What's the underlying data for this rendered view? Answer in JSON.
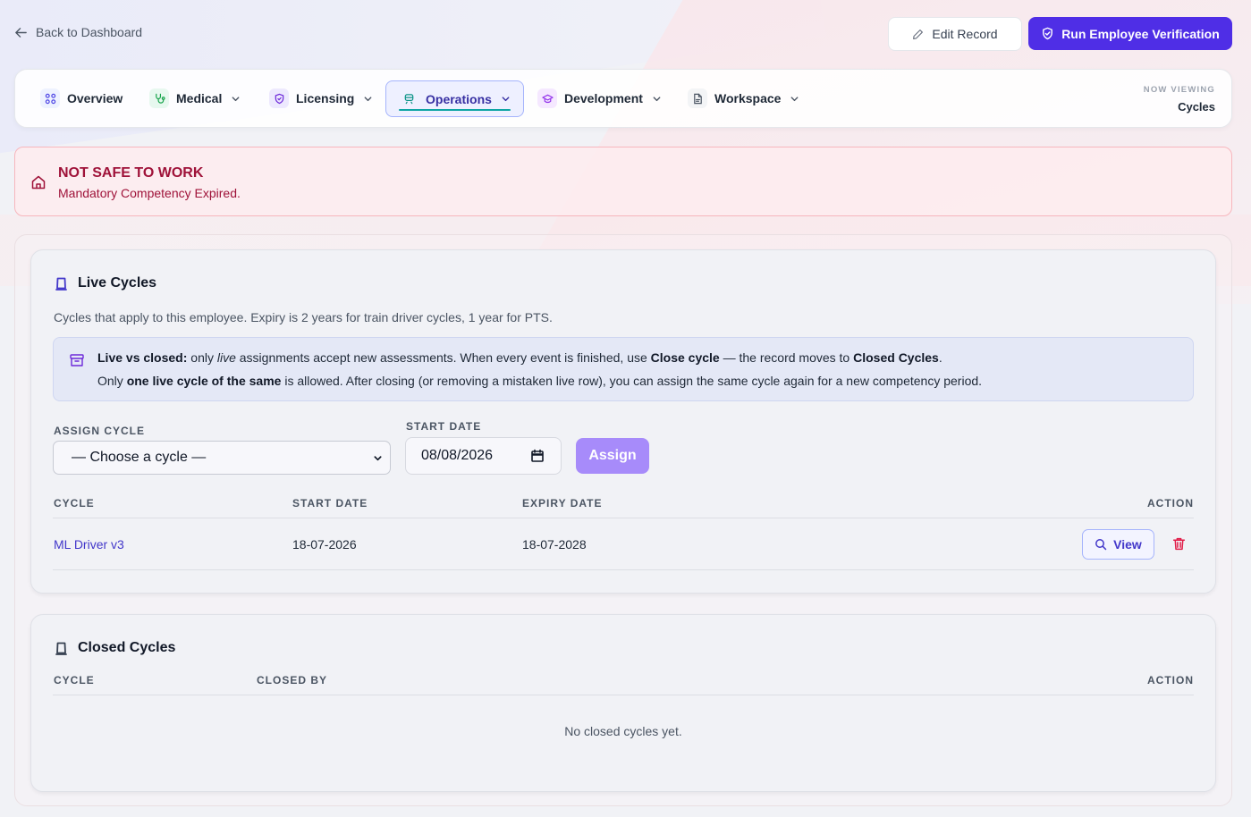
{
  "topbar": {
    "back_label": "Back to Dashboard",
    "edit_label": "Edit Record",
    "verify_label": "Run Employee Verification"
  },
  "nav": {
    "items": [
      {
        "label": "Overview",
        "icon": "grid-icon"
      },
      {
        "label": "Medical",
        "icon": "stethoscope-icon"
      },
      {
        "label": "Licensing",
        "icon": "shield-icon"
      },
      {
        "label": "Operations",
        "icon": "train-icon"
      },
      {
        "label": "Development",
        "icon": "graduation-cap-icon"
      },
      {
        "label": "Workspace",
        "icon": "document-icon"
      }
    ],
    "now_viewing_label": "NOW VIEWING",
    "now_viewing_value": "Cycles"
  },
  "alert": {
    "title": "NOT SAFE TO WORK",
    "message": "Mandatory Competency Expired."
  },
  "live": {
    "title": "Live Cycles",
    "description": "Cycles that apply to this employee. Expiry is 2 years for train driver cycles, 1 year for PTS.",
    "info": {
      "l1_b1": "Live vs closed:",
      "l1_t1": " only ",
      "l1_i1": "live",
      "l1_t2": " assignments accept new assessments. When every event is finished, use ",
      "l1_b2": "Close cycle",
      "l1_t3": " — the record moves to ",
      "l1_b3": "Closed Cycles",
      "l1_t4": ".",
      "l2_t1": "Only ",
      "l2_b1": "one live cycle of the same",
      "l2_t2": " is allowed. After closing (or removing a mistaken live row), you can assign the same cycle again for a new competency period."
    },
    "assign_cycle_label": "ASSIGN CYCLE",
    "select_value": "— Choose a cycle —",
    "start_date_label": "START DATE",
    "start_date_value": "08/08/2026",
    "assign_label": "Assign",
    "columns": [
      "CYCLE",
      "START DATE",
      "EXPIRY DATE",
      "ACTION"
    ],
    "rows": [
      {
        "cycle": "ML Driver v3",
        "start": "18-07-2026",
        "expiry": "18-07-2028",
        "view_label": "View"
      }
    ]
  },
  "closed": {
    "title": "Closed Cycles",
    "columns": [
      "CYCLE",
      "CLOSED BY",
      "ACTION"
    ],
    "empty_text": "No closed cycles yet."
  },
  "colors": {
    "accent": "#4f2ee6",
    "danger": "#9f1239",
    "link": "#4338ca"
  }
}
